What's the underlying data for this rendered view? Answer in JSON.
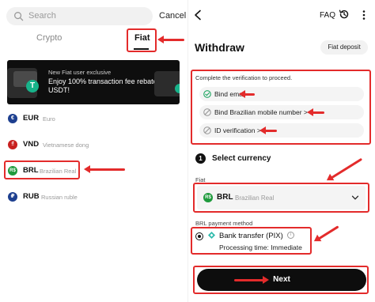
{
  "search": {
    "placeholder": "Search"
  },
  "cancel_label": "Cancel",
  "tabs": [
    {
      "label": "Crypto"
    },
    {
      "label": "Fiat"
    }
  ],
  "banner": {
    "line1": "New Fiat user exclusive",
    "line2": "Enjoy 100% transaction fee rebates in USDT!"
  },
  "currencies": [
    {
      "code": "EUR",
      "name": "Euro",
      "symbol": "€",
      "color": "#1d3f8f"
    },
    {
      "code": "VND",
      "name": "Vietnamese dong",
      "symbol": "₫",
      "color": "#c8201f"
    },
    {
      "code": "BRL",
      "name": "Brazilian Real",
      "symbol": "R$",
      "color": "#1e9a3c"
    },
    {
      "code": "RUB",
      "name": "Russian ruble",
      "symbol": "₽",
      "color": "#1d3f8f"
    }
  ],
  "header": {
    "faq": "FAQ"
  },
  "withdraw": {
    "title": "Withdraw",
    "fiat_deposit": "Fiat deposit",
    "verification_note": "Complete the verification to proceed.",
    "verifications": [
      {
        "label": "Bind email",
        "status": "done"
      },
      {
        "label": "Bind Brazilian mobile number >",
        "status": "pending"
      },
      {
        "label": "ID verification >",
        "status": "pending"
      }
    ],
    "step_number": "1",
    "step_title": "Select currency",
    "fiat_label": "Fiat",
    "selected_fiat": {
      "code": "BRL",
      "name": "Brazilian Real",
      "symbol": "R$"
    },
    "payment_label": "BRL payment method",
    "payment_method": "Bank transfer (PIX)",
    "info_symbol": "i",
    "processing_time": "Processing time: Immediate",
    "next_label": "Next"
  },
  "colors": {
    "annotation_red": "#e32b2b",
    "accent_black": "#0d0d0d",
    "pix_teal": "#32bcad",
    "verified_green": "#17a35c"
  }
}
